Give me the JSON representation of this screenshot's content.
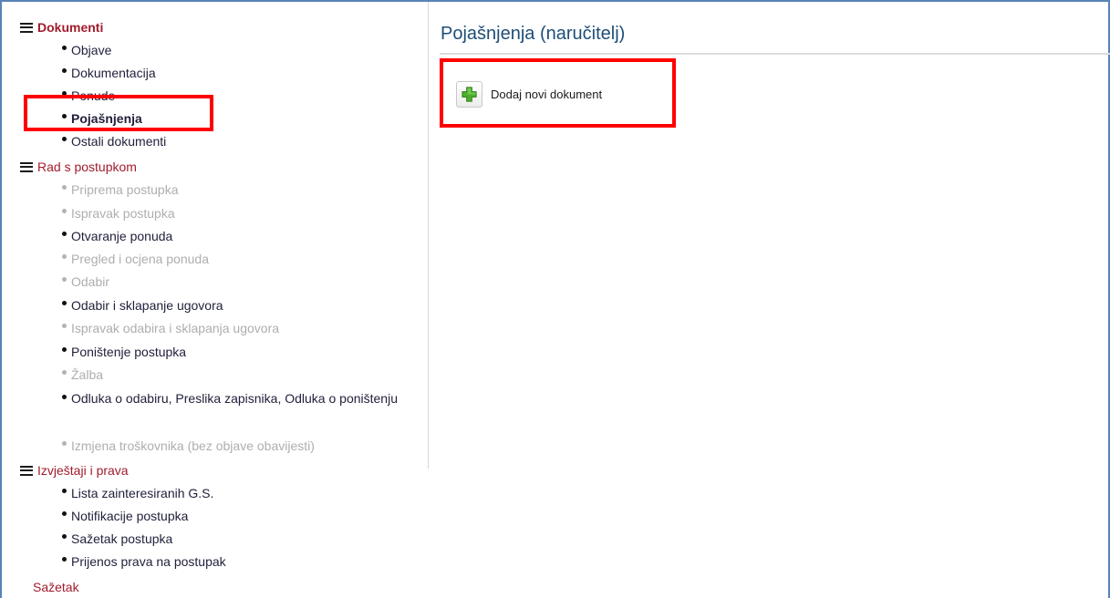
{
  "sidebar": {
    "sections": [
      {
        "label": "Dokumenti",
        "items": [
          {
            "label": "Objave",
            "state": "enabled"
          },
          {
            "label": "Dokumentacija",
            "state": "enabled"
          },
          {
            "label": "Ponude",
            "state": "enabled"
          },
          {
            "label": "Pojašnjenja",
            "state": "selected"
          },
          {
            "label": "Ostali dokumenti",
            "state": "enabled"
          }
        ]
      },
      {
        "label": "Rad s postupkom",
        "items": [
          {
            "label": "Priprema postupka",
            "state": "disabled"
          },
          {
            "label": "Ispravak postupka",
            "state": "disabled"
          },
          {
            "label": "Otvaranje ponuda",
            "state": "enabled"
          },
          {
            "label": "Pregled i ocjena ponuda",
            "state": "disabled"
          },
          {
            "label": "Odabir",
            "state": "disabled"
          },
          {
            "label": "Odabir i sklapanje ugovora",
            "state": "enabled"
          },
          {
            "label": "Ispravak odabira i sklapanja ugovora",
            "state": "disabled"
          },
          {
            "label": "Poništenje postupka",
            "state": "enabled"
          },
          {
            "label": "Žalba",
            "state": "disabled"
          },
          {
            "label": "Odluka o odabiru, Preslika zapisnika, Odluka o poništenju",
            "state": "enabled"
          },
          {
            "label": "Izmjena troškovnika (bez objave obavijesti)",
            "state": "disabled"
          }
        ]
      },
      {
        "label": "Izvještaji i prava",
        "items": [
          {
            "label": "Lista zainteresiranih G.S.",
            "state": "enabled"
          },
          {
            "label": "Notifikacije postupka",
            "state": "enabled"
          },
          {
            "label": "Sažetak postupka",
            "state": "enabled"
          },
          {
            "label": "Prijenos prava na postupak",
            "state": "enabled"
          }
        ]
      }
    ],
    "summary_link": "Sažetak"
  },
  "main": {
    "title": "Pojašnjenja (naručitelj)",
    "add_button_label": "Dodaj novi dokument",
    "add_icon": "plus-icon"
  },
  "colors": {
    "section_header": "#a01c2c",
    "title": "#1e4e78",
    "disabled_item": "#aeaeae",
    "highlight": "#ff0000",
    "plus_green": "#4caf2b",
    "frame_border": "#5a82b8"
  }
}
